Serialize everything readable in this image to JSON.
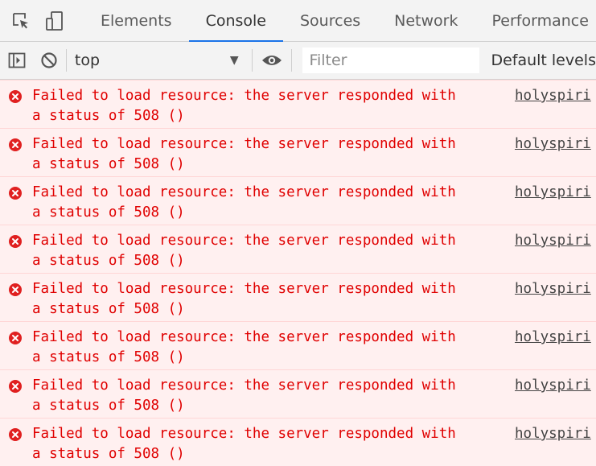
{
  "tabs": [
    {
      "label": "Elements",
      "active": false
    },
    {
      "label": "Console",
      "active": true
    },
    {
      "label": "Sources",
      "active": false
    },
    {
      "label": "Network",
      "active": false
    },
    {
      "label": "Performance",
      "active": false
    }
  ],
  "toolbar": {
    "context": "top",
    "filter_placeholder": "Filter",
    "levels_label": "Default levels"
  },
  "icons": {
    "inspect": "inspect-element-icon",
    "device": "device-toolbar-icon",
    "sidebar": "sidebar-toggle-icon",
    "clear": "clear-console-icon",
    "eye": "live-expression-icon",
    "error": "error-icon"
  },
  "colors": {
    "error_text": "#e00000",
    "error_bg": "#fff0f0",
    "active_tab_underline": "#1a73e8"
  },
  "messages": [
    {
      "line1": "Failed to load resource: the server responded with",
      "line2": "a status of 508 ()",
      "source": "holyspiri"
    },
    {
      "line1": "Failed to load resource: the server responded with",
      "line2": "a status of 508 ()",
      "source": "holyspiri"
    },
    {
      "line1": "Failed to load resource: the server responded with",
      "line2": "a status of 508 ()",
      "source": "holyspiri"
    },
    {
      "line1": "Failed to load resource: the server responded with",
      "line2": "a status of 508 ()",
      "source": "holyspiri"
    },
    {
      "line1": "Failed to load resource: the server responded with",
      "line2": "a status of 508 ()",
      "source": "holyspiri"
    },
    {
      "line1": "Failed to load resource: the server responded with",
      "line2": "a status of 508 ()",
      "source": "holyspiri"
    },
    {
      "line1": "Failed to load resource: the server responded with",
      "line2": "a status of 508 ()",
      "source": "holyspiri"
    },
    {
      "line1": "Failed to load resource: the server responded with",
      "line2": "a status of 508 ()",
      "source": "holyspiri"
    }
  ]
}
